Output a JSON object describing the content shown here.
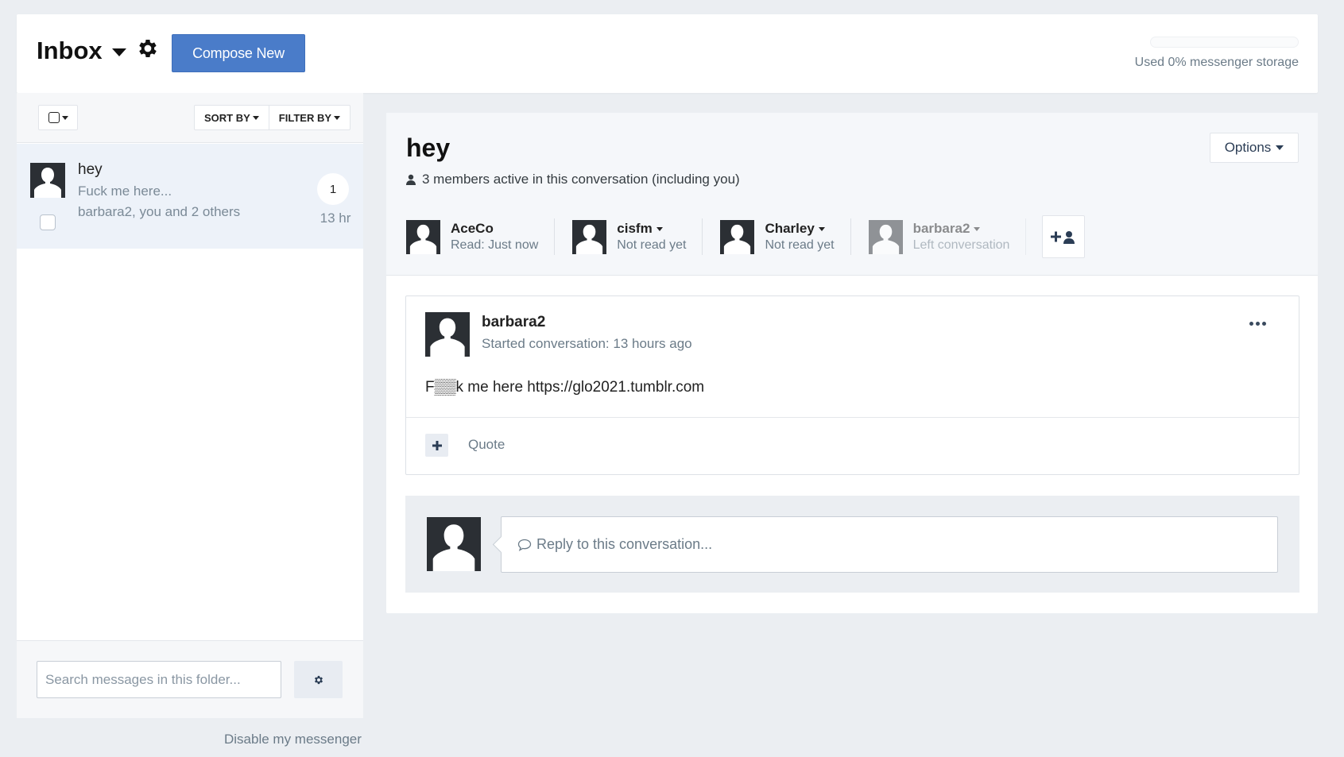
{
  "header": {
    "title": "Inbox",
    "compose_label": "Compose New",
    "storage_percent": 0,
    "storage_text": "Used 0% messenger storage"
  },
  "sidebar": {
    "sort_label": "SORT BY",
    "filter_label": "FILTER BY",
    "conversations": [
      {
        "title": "hey",
        "snippet": "Fuck me here...",
        "members": "barbara2, you and 2 others",
        "count": "1",
        "time": "13 hr"
      }
    ],
    "search_placeholder": "Search messages in this folder...",
    "disable_link": "Disable my messenger"
  },
  "conversation": {
    "title": "hey",
    "members_text": "3 members active in this conversation (including you)",
    "options_label": "Options",
    "participants": [
      {
        "name": "AceCo",
        "status": "Read: Just now"
      },
      {
        "name": "cisfm",
        "status": "Not read yet"
      },
      {
        "name": "Charley",
        "status": "Not read yet"
      },
      {
        "name": "barbara2",
        "status": "Left conversation"
      }
    ],
    "message": {
      "author": "barbara2",
      "meta": "Started conversation: 13 hours ago",
      "body": "F▒▒k me here https://glo2021.tumblr.com",
      "quote_label": "Quote"
    },
    "reply_placeholder": "Reply to this conversation..."
  },
  "colors": {
    "accent": "#4a7cc9",
    "background": "#ebeef2",
    "selected_item": "#edf2f9"
  }
}
